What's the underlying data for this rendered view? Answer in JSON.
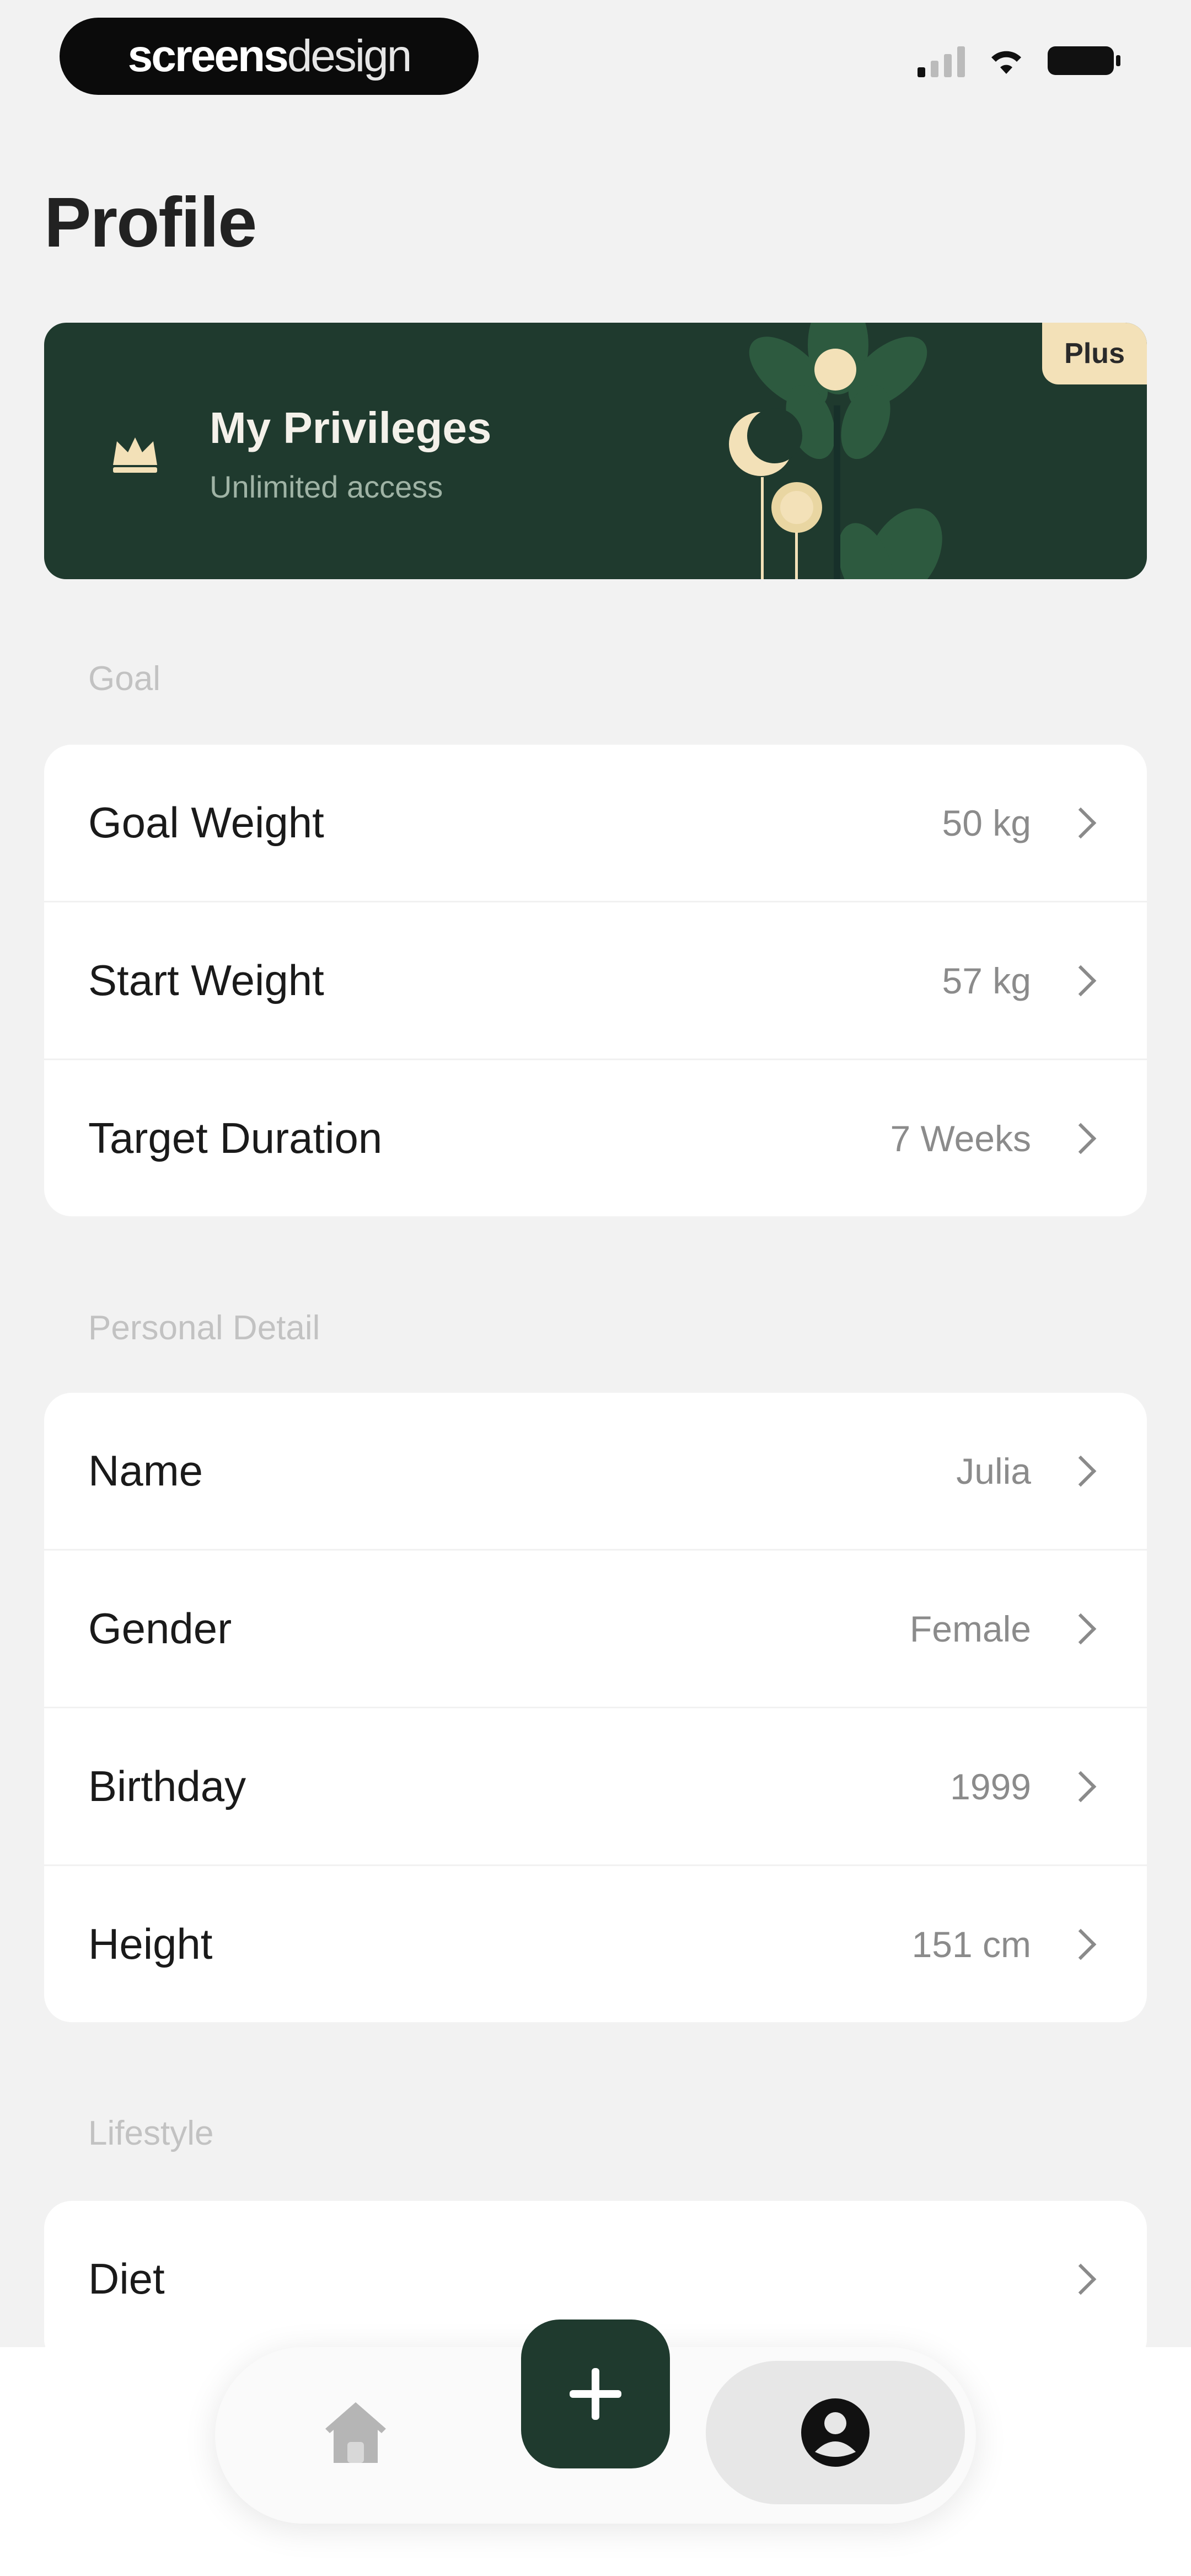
{
  "status_bar": {
    "brand_bold": "screens",
    "brand_light": "design"
  },
  "page": {
    "title": "Profile"
  },
  "privileges": {
    "title": "My Privileges",
    "subtitle": "Unlimited access",
    "badge": "Plus",
    "colors": {
      "card": "#1f3a2e",
      "badge": "#f3e1b8"
    }
  },
  "sections": [
    {
      "label": "Goal",
      "rows": [
        {
          "label": "Goal Weight",
          "value": "50 kg"
        },
        {
          "label": "Start Weight",
          "value": "57 kg"
        },
        {
          "label": "Target Duration",
          "value": "7 Weeks"
        }
      ]
    },
    {
      "label": "Personal Detail",
      "rows": [
        {
          "label": "Name",
          "value": "Julia"
        },
        {
          "label": "Gender",
          "value": "Female"
        },
        {
          "label": "Birthday",
          "value": "1999"
        },
        {
          "label": "Height",
          "value": "151 cm"
        }
      ]
    },
    {
      "label": "Lifestyle",
      "rows": [
        {
          "label": "Diet",
          "value": ""
        }
      ]
    }
  ],
  "bottom_nav": {
    "items": [
      {
        "icon": "home-icon",
        "active": false
      },
      {
        "icon": "plus-icon",
        "active": false
      },
      {
        "icon": "profile-icon",
        "active": true
      }
    ],
    "accent": "#1f3a2e"
  }
}
